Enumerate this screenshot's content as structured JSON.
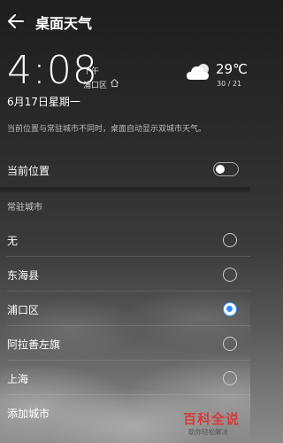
{
  "header": {
    "title": "桌面天气",
    "back_icon": "arrow-left-icon"
  },
  "clock": {
    "time": "4:08",
    "ampm": "下午",
    "district": "浦口区",
    "date": "6月17日星期一"
  },
  "weather": {
    "condition_icon": "partly-cloudy-icon",
    "temperature": "29℃",
    "range": "30 / 21"
  },
  "note": "当前位置与常驻城市不同时，桌面自动显示双城市天气。",
  "current_location": {
    "label": "当前位置",
    "enabled": false
  },
  "resident_city": {
    "section_title": "常驻城市",
    "options": [
      {
        "label": "无",
        "selected": false
      },
      {
        "label": "东海县",
        "selected": false
      },
      {
        "label": "浦口区",
        "selected": true
      },
      {
        "label": "阿拉善左旗",
        "selected": false
      },
      {
        "label": "上海",
        "selected": false
      }
    ],
    "add_label": "添加城市"
  },
  "colors": {
    "accent": "#2f8cff",
    "watermark_red": "#d83a3a"
  },
  "watermark": {
    "title": "百科全说",
    "subtitle": "助你轻松解决"
  }
}
